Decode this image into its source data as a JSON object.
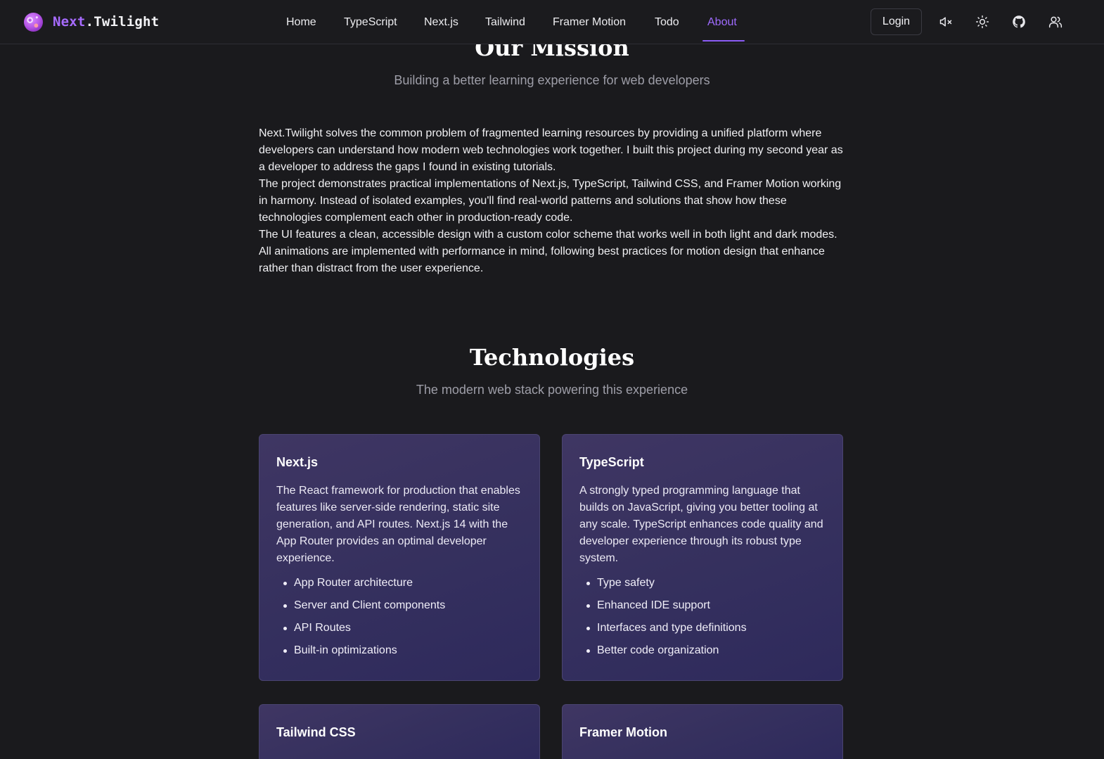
{
  "brand": {
    "name_highlight": "Next",
    "name_rest": ".Twilight"
  },
  "nav": {
    "items": [
      {
        "label": "Home"
      },
      {
        "label": "TypeScript"
      },
      {
        "label": "Next.js"
      },
      {
        "label": "Tailwind"
      },
      {
        "label": "Framer Motion"
      },
      {
        "label": "Todo"
      },
      {
        "label": "About",
        "active": true
      }
    ],
    "login_label": "Login",
    "icons": [
      "speaker-muted-icon",
      "sun-icon",
      "github-icon",
      "users-icon"
    ]
  },
  "colors": {
    "accent": "#9f6bff",
    "background": "#1a1a1d",
    "card_bg": "#3a3262"
  },
  "mission": {
    "title": "Our Mission",
    "subtitle": "Building a better learning experience for web developers",
    "paragraphs": [
      "Next.Twilight solves the common problem of fragmented learning resources by providing a unified platform where developers can understand how modern web technologies work together. I built this project during my second year as a developer to address the gaps I found in existing tutorials.",
      "The project demonstrates practical implementations of Next.js, TypeScript, Tailwind CSS, and Framer Motion working in harmony. Instead of isolated examples, you'll find real-world patterns and solutions that show how these technologies complement each other in production-ready code.",
      "The UI features a clean, accessible design with a custom color scheme that works well in both light and dark modes. All animations are implemented with performance in mind, following best practices for motion design that enhance rather than distract from the user experience."
    ]
  },
  "technologies": {
    "title": "Technologies",
    "subtitle": "The modern web stack powering this experience",
    "cards": [
      {
        "title": "Next.js",
        "description": "The React framework for production that enables features like server-side rendering, static site generation, and API routes. Next.js 14 with the App Router provides an optimal developer experience.",
        "features": [
          "App Router architecture",
          "Server and Client components",
          "API Routes",
          "Built-in optimizations"
        ]
      },
      {
        "title": "TypeScript",
        "description": "A strongly typed programming language that builds on JavaScript, giving you better tooling at any scale. TypeScript enhances code quality and developer experience through its robust type system.",
        "features": [
          "Type safety",
          "Enhanced IDE support",
          "Interfaces and type definitions",
          "Better code organization"
        ]
      },
      {
        "title": "Tailwind CSS"
      },
      {
        "title": "Framer Motion"
      }
    ]
  }
}
